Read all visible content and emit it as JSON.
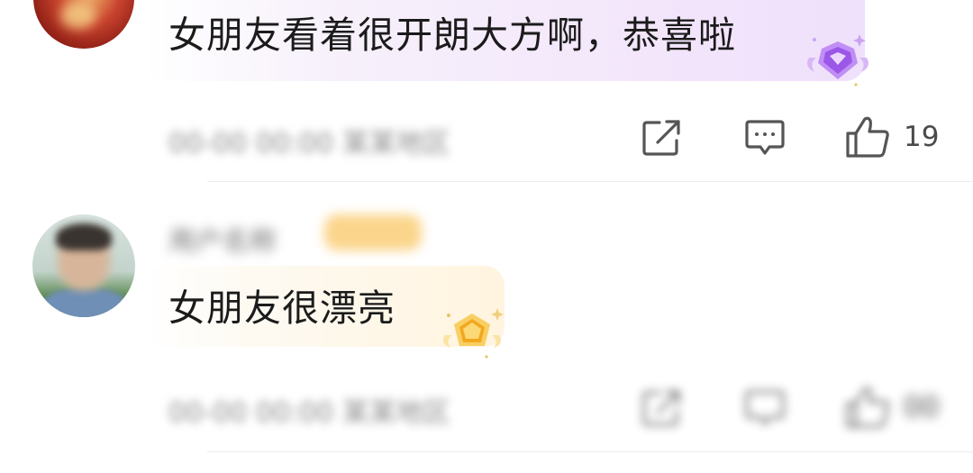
{
  "comments": [
    {
      "text": "女朋友看着很开朗大方啊，恭喜啦",
      "meta": "00-00 00:00 某某地区",
      "like_count": "19",
      "badge_icon": "purple-diamond-badge-icon",
      "badge_color": "#b77bf2",
      "bubble_color": "#f3e6fb"
    },
    {
      "username": "用户名称",
      "text": "女朋友很漂亮",
      "meta": "00-00 00:00 某某地区",
      "like_count": "00",
      "badge_icon": "gold-pentagon-badge-icon",
      "badge_color": "#f5b82e",
      "bubble_color": "#fff4df"
    }
  ]
}
